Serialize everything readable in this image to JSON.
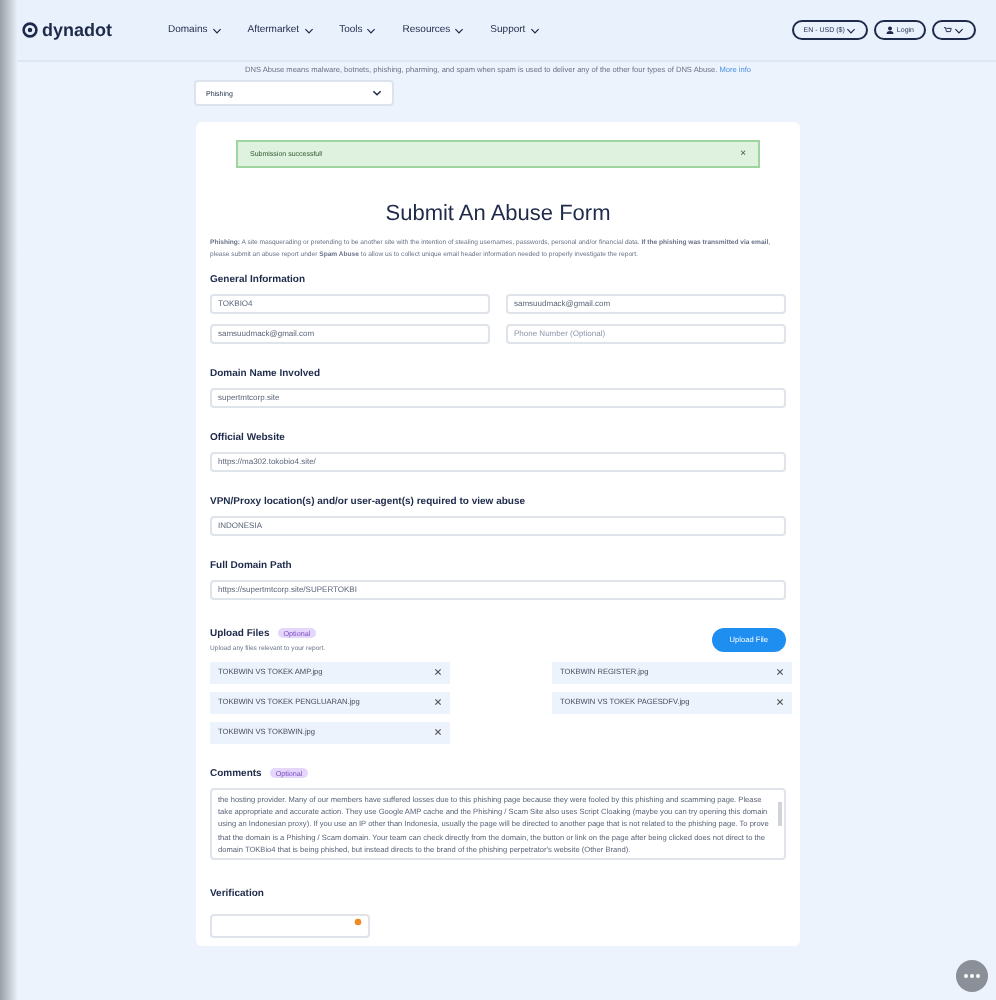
{
  "header": {
    "logo": "dynadot",
    "nav": [
      {
        "label": "Domains"
      },
      {
        "label": "Aftermarket"
      },
      {
        "label": "Tools"
      },
      {
        "label": "Resources"
      },
      {
        "label": "Support"
      }
    ],
    "currency": "EN - USD ($)",
    "login": "Login"
  },
  "intro": {
    "text": "DNS Abuse means malware, botnets, phishing, pharming, and spam when spam is used to deliver any of the other four types of DNS Abuse.",
    "link": "More info"
  },
  "abuse_type": {
    "value": "Phishing"
  },
  "alert": {
    "message": "Submission successful!",
    "close": "×"
  },
  "title": "Submit An Abuse Form",
  "description": "**Phishing:** A site masquerading or pretending to be another site with the intention of stealing usernames, passwords, personal and/or financial data. **If the phishing was transmitted via email**, please submit an abuse report under **Spam Abuse** to allow us to collect unique email header information needed to properly investigate the report.",
  "general": {
    "heading": "General Information",
    "fields": [
      {
        "value": "TOKBIO4"
      },
      {
        "value": "samsuudmack@gmail.com"
      },
      {
        "value": "samsuudmack@gmail.com"
      },
      {
        "placeholder": "Phone Number (Optional)"
      }
    ]
  },
  "sections": [
    {
      "label": "Domain Name Involved",
      "value": "supertmtcorp.site"
    },
    {
      "label": "Official Website",
      "value": "https://ma302.tokobio4.site/"
    },
    {
      "label": "VPN/Proxy location(s) and/or user-agent(s) required to view abuse",
      "value": "INDONESIA"
    },
    {
      "label": "Full Domain Path",
      "value": "https://supertmtcorp.site/SUPERTOKBI"
    }
  ],
  "upload": {
    "heading": "Upload Files",
    "badge": "Optional",
    "hint": "Upload any files relevant to your report.",
    "button": "Upload File",
    "files": [
      {
        "name": "TOKBWIN VS TOKEK AMP.jpg"
      },
      {
        "name": "TOKBWIN REGISTER.jpg"
      },
      {
        "name": "TOKBWIN VS TOKEK PENGLUARAN.jpg"
      },
      {
        "name": "TOKBWIN VS TOKEK PAGESDFV.jpg"
      },
      {
        "name": "TOKBWIN VS TOKBWIN.jpg"
      }
    ]
  },
  "comments": {
    "heading": "Comments",
    "badge": "Optional",
    "text": "the hosting provider. Many of our members have suffered losses due to this phishing page because they were fooled by this phishing and scamming page. Please take appropriate and accurate action. They use Google AMP cache and the Phishing / Scam Site also uses Script Cloaking (maybe you can try opening this domain using an Indonesian proxy). If you use an IP other than Indonesia, usually the page will be directed to another page that is not related to the phishing page. To prove that the domain is a Phishing / Scam domain. Your team can check directly from the domain, the button or link on the page after being clicked does not direct to the domain TOKBio4 that is being phished, but instead directs to the brand of the phishing perpetrator's website (Other Brand)."
  },
  "verification": {
    "heading": "Verification"
  }
}
